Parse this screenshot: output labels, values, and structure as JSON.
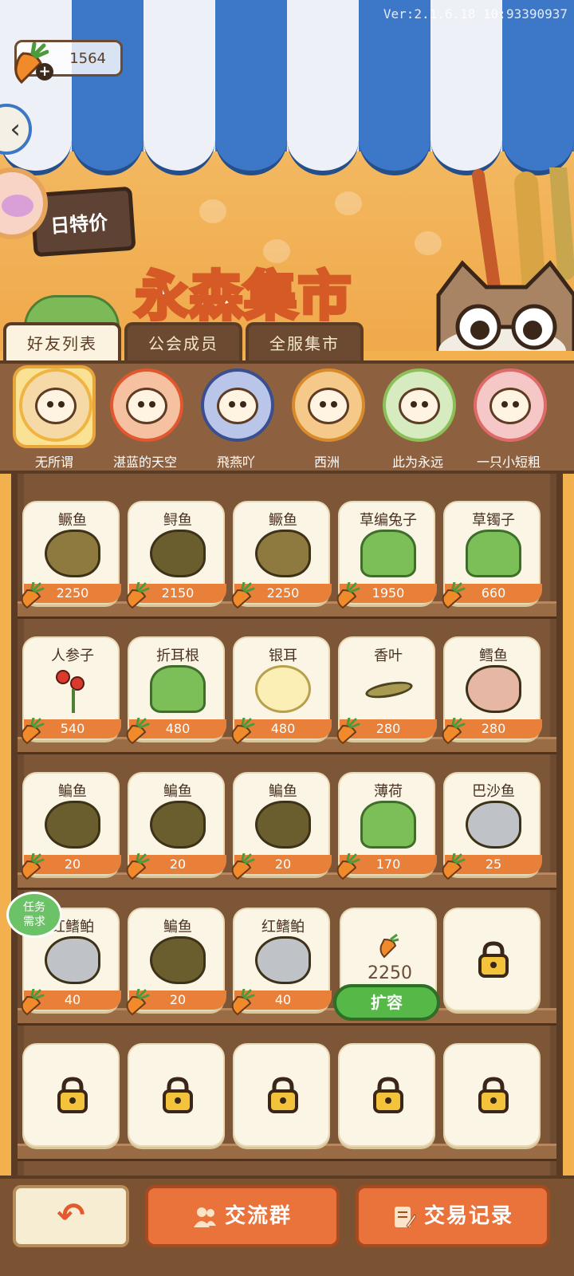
{
  "header": {
    "version": "Ver:2.1.6.18 10:93390937",
    "currency_amount": "1564",
    "daily_deal_label": "日特价",
    "market_title": "永森集市"
  },
  "tabs": [
    {
      "label": "好友列表",
      "active": true
    },
    {
      "label": "公会成员",
      "active": false
    },
    {
      "label": "全服集市",
      "active": false
    }
  ],
  "friends": [
    {
      "name": "无所谓",
      "selected": true
    },
    {
      "name": "湛蓝的天空",
      "selected": false
    },
    {
      "name": "飛燕吖",
      "selected": false
    },
    {
      "name": "西洲",
      "selected": false
    },
    {
      "name": "此为永远",
      "selected": false
    },
    {
      "name": "一只小短粗",
      "selected": false
    }
  ],
  "shelf": {
    "rows": [
      [
        {
          "name": "鳜鱼",
          "price": "2250",
          "icon": "mandarin-fish"
        },
        {
          "name": "鲟鱼",
          "price": "2150",
          "icon": "sturgeon"
        },
        {
          "name": "鳜鱼",
          "price": "2250",
          "icon": "mandarin-fish"
        },
        {
          "name": "草编兔子",
          "price": "1950",
          "icon": "straw-rabbit"
        },
        {
          "name": "草镯子",
          "price": "660",
          "icon": "grass-bracelet"
        }
      ],
      [
        {
          "name": "人参子",
          "price": "540",
          "icon": "ginseng-berry"
        },
        {
          "name": "折耳根",
          "price": "480",
          "icon": "houttuynia"
        },
        {
          "name": "银耳",
          "price": "480",
          "icon": "tremella"
        },
        {
          "name": "香叶",
          "price": "280",
          "icon": "bay-leaf"
        },
        {
          "name": "鳕鱼",
          "price": "280",
          "icon": "cod"
        }
      ],
      [
        {
          "name": "鳊鱼",
          "price": "20",
          "icon": "bream"
        },
        {
          "name": "鳊鱼",
          "price": "20",
          "icon": "bream"
        },
        {
          "name": "鳊鱼",
          "price": "20",
          "icon": "bream"
        },
        {
          "name": "薄荷",
          "price": "170",
          "icon": "mint"
        },
        {
          "name": "巴沙鱼",
          "price": "25",
          "icon": "basa-fish"
        }
      ],
      [
        {
          "name": "红鳍鲌",
          "price": "40",
          "icon": "redfin"
        },
        {
          "name": "鳊鱼",
          "price": "20",
          "icon": "bream"
        },
        {
          "name": "红鳍鲌",
          "price": "40",
          "icon": "redfin"
        }
      ]
    ],
    "expand": {
      "price": "2250",
      "button_label": "扩容"
    },
    "task_badge": "任务\n需求"
  },
  "bottom": {
    "group_label": "交流群",
    "records_label": "交易记录"
  },
  "colors": {
    "accent_orange": "#e9733a",
    "wood_brown": "#7b5232",
    "awning_blue": "#3c78c7",
    "green_button": "#55b847"
  }
}
